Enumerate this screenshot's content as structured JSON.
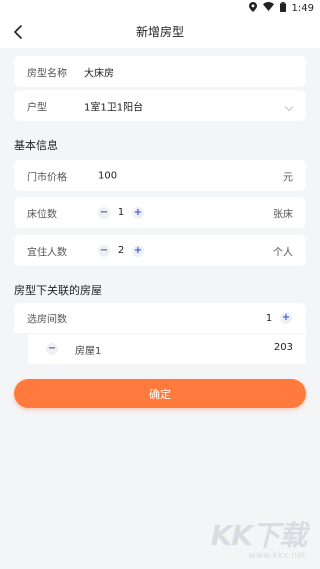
{
  "status_bar": {
    "time": "1:49"
  },
  "nav": {
    "title": "新增房型"
  },
  "room_type": {
    "name_label": "房型名称",
    "name_value": "大床房",
    "layout_label": "户型",
    "layout_value": "1室1卫1阳台"
  },
  "basic_info": {
    "section_title": "基本信息",
    "price_label": "门市价格",
    "price_value": "100",
    "price_unit": "元",
    "beds_label": "床位数",
    "beds_value": "1",
    "beds_unit": "张床",
    "guests_label": "宜住人数",
    "guests_value": "2",
    "guests_unit": "个人"
  },
  "linked_rooms": {
    "section_title": "房型下关联的房屋",
    "count_label": "选房间数",
    "count_value": "1",
    "rooms": [
      {
        "label": "房屋1",
        "number": "203"
      }
    ]
  },
  "stepper": {
    "minus": "−",
    "plus": "+"
  },
  "confirm_label": "确定",
  "watermark": {
    "logo": "KK下载",
    "url": "www.kkx.net"
  }
}
